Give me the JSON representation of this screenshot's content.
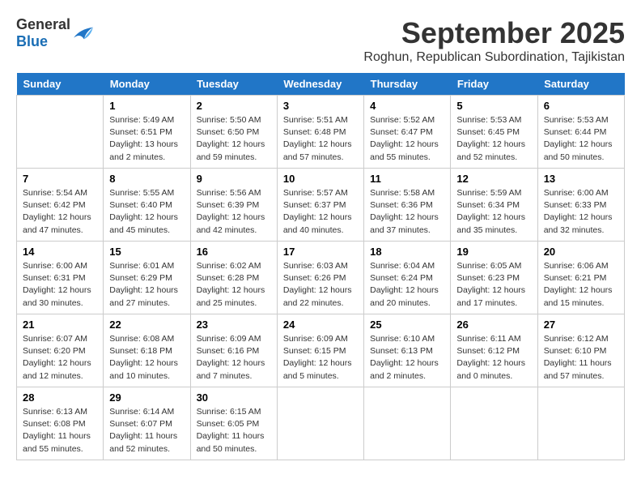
{
  "logo": {
    "general": "General",
    "blue": "Blue"
  },
  "header": {
    "month": "September 2025",
    "location": "Roghun, Republican Subordination, Tajikistan"
  },
  "weekdays": [
    "Sunday",
    "Monday",
    "Tuesday",
    "Wednesday",
    "Thursday",
    "Friday",
    "Saturday"
  ],
  "weeks": [
    [
      {
        "day": "",
        "info": ""
      },
      {
        "day": "1",
        "info": "Sunrise: 5:49 AM\nSunset: 6:51 PM\nDaylight: 13 hours\nand 2 minutes."
      },
      {
        "day": "2",
        "info": "Sunrise: 5:50 AM\nSunset: 6:50 PM\nDaylight: 12 hours\nand 59 minutes."
      },
      {
        "day": "3",
        "info": "Sunrise: 5:51 AM\nSunset: 6:48 PM\nDaylight: 12 hours\nand 57 minutes."
      },
      {
        "day": "4",
        "info": "Sunrise: 5:52 AM\nSunset: 6:47 PM\nDaylight: 12 hours\nand 55 minutes."
      },
      {
        "day": "5",
        "info": "Sunrise: 5:53 AM\nSunset: 6:45 PM\nDaylight: 12 hours\nand 52 minutes."
      },
      {
        "day": "6",
        "info": "Sunrise: 5:53 AM\nSunset: 6:44 PM\nDaylight: 12 hours\nand 50 minutes."
      }
    ],
    [
      {
        "day": "7",
        "info": "Sunrise: 5:54 AM\nSunset: 6:42 PM\nDaylight: 12 hours\nand 47 minutes."
      },
      {
        "day": "8",
        "info": "Sunrise: 5:55 AM\nSunset: 6:40 PM\nDaylight: 12 hours\nand 45 minutes."
      },
      {
        "day": "9",
        "info": "Sunrise: 5:56 AM\nSunset: 6:39 PM\nDaylight: 12 hours\nand 42 minutes."
      },
      {
        "day": "10",
        "info": "Sunrise: 5:57 AM\nSunset: 6:37 PM\nDaylight: 12 hours\nand 40 minutes."
      },
      {
        "day": "11",
        "info": "Sunrise: 5:58 AM\nSunset: 6:36 PM\nDaylight: 12 hours\nand 37 minutes."
      },
      {
        "day": "12",
        "info": "Sunrise: 5:59 AM\nSunset: 6:34 PM\nDaylight: 12 hours\nand 35 minutes."
      },
      {
        "day": "13",
        "info": "Sunrise: 6:00 AM\nSunset: 6:33 PM\nDaylight: 12 hours\nand 32 minutes."
      }
    ],
    [
      {
        "day": "14",
        "info": "Sunrise: 6:00 AM\nSunset: 6:31 PM\nDaylight: 12 hours\nand 30 minutes."
      },
      {
        "day": "15",
        "info": "Sunrise: 6:01 AM\nSunset: 6:29 PM\nDaylight: 12 hours\nand 27 minutes."
      },
      {
        "day": "16",
        "info": "Sunrise: 6:02 AM\nSunset: 6:28 PM\nDaylight: 12 hours\nand 25 minutes."
      },
      {
        "day": "17",
        "info": "Sunrise: 6:03 AM\nSunset: 6:26 PM\nDaylight: 12 hours\nand 22 minutes."
      },
      {
        "day": "18",
        "info": "Sunrise: 6:04 AM\nSunset: 6:24 PM\nDaylight: 12 hours\nand 20 minutes."
      },
      {
        "day": "19",
        "info": "Sunrise: 6:05 AM\nSunset: 6:23 PM\nDaylight: 12 hours\nand 17 minutes."
      },
      {
        "day": "20",
        "info": "Sunrise: 6:06 AM\nSunset: 6:21 PM\nDaylight: 12 hours\nand 15 minutes."
      }
    ],
    [
      {
        "day": "21",
        "info": "Sunrise: 6:07 AM\nSunset: 6:20 PM\nDaylight: 12 hours\nand 12 minutes."
      },
      {
        "day": "22",
        "info": "Sunrise: 6:08 AM\nSunset: 6:18 PM\nDaylight: 12 hours\nand 10 minutes."
      },
      {
        "day": "23",
        "info": "Sunrise: 6:09 AM\nSunset: 6:16 PM\nDaylight: 12 hours\nand 7 minutes."
      },
      {
        "day": "24",
        "info": "Sunrise: 6:09 AM\nSunset: 6:15 PM\nDaylight: 12 hours\nand 5 minutes."
      },
      {
        "day": "25",
        "info": "Sunrise: 6:10 AM\nSunset: 6:13 PM\nDaylight: 12 hours\nand 2 minutes."
      },
      {
        "day": "26",
        "info": "Sunrise: 6:11 AM\nSunset: 6:12 PM\nDaylight: 12 hours\nand 0 minutes."
      },
      {
        "day": "27",
        "info": "Sunrise: 6:12 AM\nSunset: 6:10 PM\nDaylight: 11 hours\nand 57 minutes."
      }
    ],
    [
      {
        "day": "28",
        "info": "Sunrise: 6:13 AM\nSunset: 6:08 PM\nDaylight: 11 hours\nand 55 minutes."
      },
      {
        "day": "29",
        "info": "Sunrise: 6:14 AM\nSunset: 6:07 PM\nDaylight: 11 hours\nand 52 minutes."
      },
      {
        "day": "30",
        "info": "Sunrise: 6:15 AM\nSunset: 6:05 PM\nDaylight: 11 hours\nand 50 minutes."
      },
      {
        "day": "",
        "info": ""
      },
      {
        "day": "",
        "info": ""
      },
      {
        "day": "",
        "info": ""
      },
      {
        "day": "",
        "info": ""
      }
    ]
  ]
}
